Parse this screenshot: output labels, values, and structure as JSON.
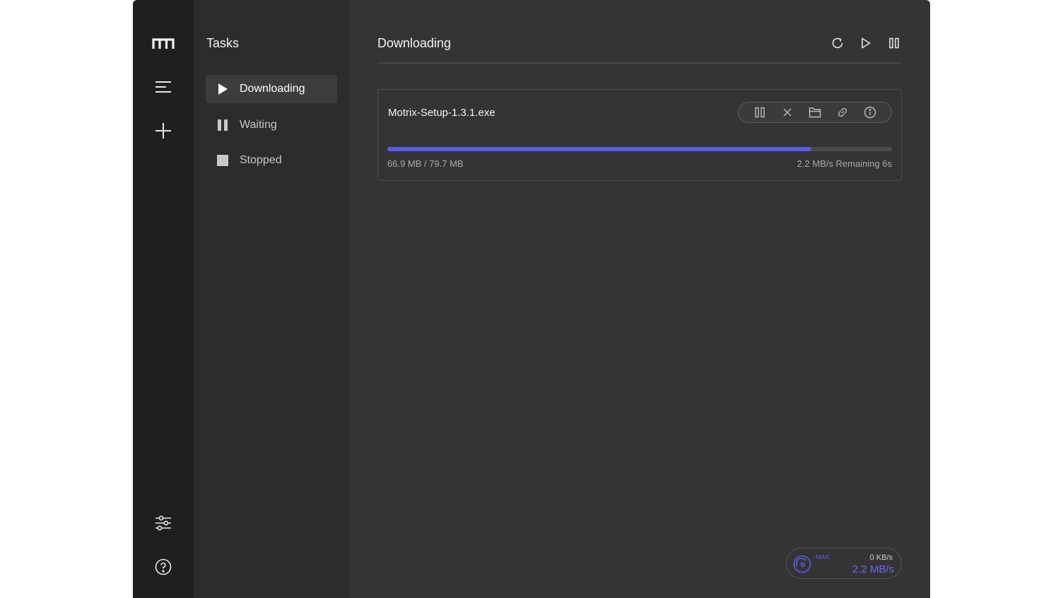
{
  "window": {
    "traffic_lights": [
      "close",
      "minimize",
      "maximize"
    ]
  },
  "rail": {
    "icons": [
      "motrix-logo-icon",
      "task-list-icon",
      "add-task-icon",
      "preferences-icon",
      "help-icon"
    ]
  },
  "sidebar": {
    "title": "Tasks",
    "items": [
      {
        "label": "Downloading",
        "icon": "play-icon",
        "active": true
      },
      {
        "label": "Waiting",
        "icon": "pause-icon",
        "active": false
      },
      {
        "label": "Stopped",
        "icon": "stop-icon",
        "active": false
      }
    ]
  },
  "main": {
    "title": "Downloading",
    "header_actions": [
      "refresh-icon",
      "resume-all-icon",
      "pause-all-icon"
    ]
  },
  "task": {
    "name": "Motrix-Setup-1.3.1.exe",
    "size": "66.9 MB / 79.7 MB",
    "speed_remaining": "2.2 MB/s Remaining 6s",
    "progress": 0.84,
    "actions": [
      "pause-icon",
      "delete-icon",
      "folder-icon",
      "link-icon",
      "info-icon"
    ]
  },
  "speedometer": {
    "mode": "MAX",
    "upload": "0 KB/s",
    "download": "2.2 MB/s"
  },
  "colors": {
    "accent": "#5b5bea",
    "rail_bg": "#1f1f1f",
    "sidebar_bg": "#2c2c2c",
    "main_bg": "#343434"
  }
}
